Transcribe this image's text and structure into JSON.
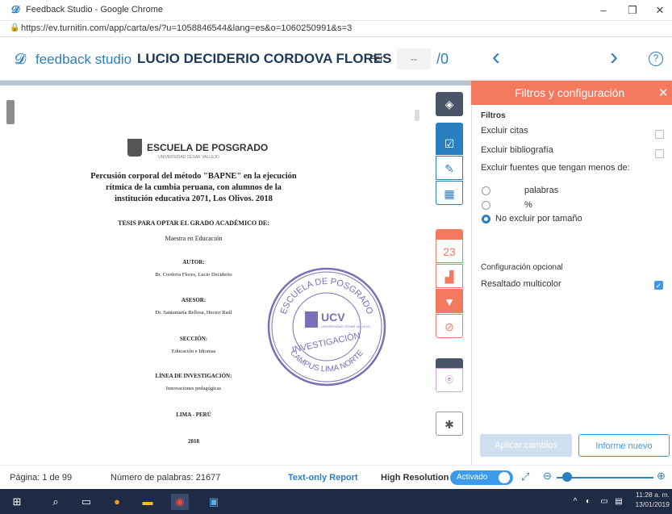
{
  "window": {
    "title": "Feedback Studio - Google Chrome",
    "min": "–",
    "restore": "❐",
    "close": "✕"
  },
  "browser": {
    "url": "https://ev.turnitin.com/app/carta/es/?u=1058846544&lang=es&o=1060250991&s=3"
  },
  "header": {
    "app_name": "feedback studio",
    "student": "LUCIO DECIDERIO CORDOVA FLORES",
    "per_label": "Per",
    "score": "--",
    "score_total": "/0",
    "prev": "‹",
    "next": "›",
    "help": "?"
  },
  "document": {
    "school": "ESCUELA DE POSGRADO",
    "university": "UNIVERSIDAD CÉSAR VALLEJO",
    "title_lines": [
      "Percusión corporal del método \"BAPNE\" en la ejecución",
      "rítmica de la cumbia peruana, con alumnos de la",
      "institución educativa 2071, Los Olivos. 2018"
    ],
    "thesis": "TESIS PARA OPTAR EL GRADO ACADÉMICO DE:",
    "degree": "Maestra en Educación",
    "author_label": "AUTOR:",
    "author": "Br. Cordova Flores, Lucio Deciderio",
    "advisor_label": "ASESOR:",
    "advisor": "Dr. Santamaría Bellosa, Hector Raúl",
    "section_label": "SECCIÓN:",
    "section": "Educación e Idiomas",
    "line_label": "LÍNEA DE INVESTIGACIÓN:",
    "line": "Innovaciones pedagógicas",
    "city": "LIMA - PERÚ",
    "year": "2018",
    "stamp_top": "ESCUELA DE POSGRADO",
    "stamp_center": "UCV",
    "stamp_sub": "UNIVERSIDAD CÉSAR VALLEJO",
    "stamp_mid": "INVESTIGACIÓN",
    "stamp_bottom": "CAMPUS LIMA NORTE"
  },
  "toolbar": {
    "similarity_count": "23"
  },
  "panel": {
    "title": "Filtros y configuración",
    "filters_heading": "Filtros",
    "exclude_quotes": "Excluir citas",
    "exclude_bibliography": "Excluir bibliografía",
    "exclude_small": "Excluir fuentes que tengan menos de:",
    "opt_words": "palabras",
    "opt_percent": "%",
    "opt_no_size": "No excluir por tamaño",
    "optional_heading": "Configuración opcional",
    "multicolor": "Resaltado multicolor",
    "apply": "Aplicar cambios",
    "new_report": "Informe nuevo"
  },
  "status": {
    "page": "Página: 1 de 99",
    "words": "Número de palabras: 21677",
    "text_only": "Text-only Report",
    "high_res": "High Resolution",
    "toggle": "Activado"
  },
  "taskbar": {
    "time": "11:28 a. m.",
    "date": "13/01/2019"
  },
  "colors": {
    "accent": "#2a7fc1",
    "panel_header": "#f5795e",
    "tool_blue": "#2a7fc1",
    "tool_red": "#f5795e",
    "tool_dark": "#4a5568",
    "stamp": "#7b6fb8"
  }
}
